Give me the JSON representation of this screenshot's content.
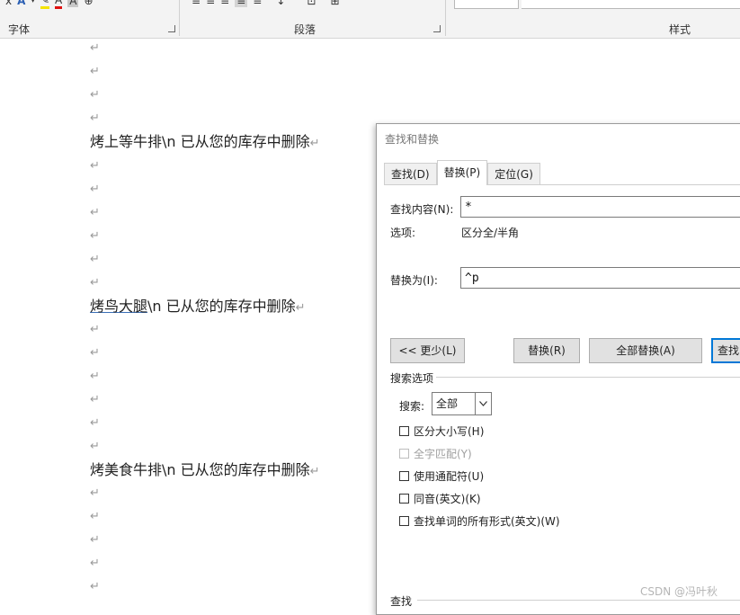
{
  "ribbon": {
    "groups": [
      {
        "label": "字体"
      },
      {
        "label": "段落"
      },
      {
        "label": "样式"
      }
    ],
    "font_tools": [
      "x",
      "A",
      "▾",
      "✎",
      "A",
      "A",
      "⊕"
    ],
    "para_tools": [
      "≡",
      "≡",
      "≡",
      "≡",
      "≡",
      "↕",
      "⊡",
      "⊞"
    ]
  },
  "document": {
    "para_mark": "↵",
    "lines": [
      {
        "text": ""
      },
      {
        "text": ""
      },
      {
        "text": ""
      },
      {
        "text": ""
      },
      {
        "text": "烤上等牛排\\n 已从您的库存中删除"
      },
      {
        "text": ""
      },
      {
        "text": ""
      },
      {
        "text": ""
      },
      {
        "text": ""
      },
      {
        "text": ""
      },
      {
        "text": ""
      },
      {
        "underlined": "烤鸟大腿",
        "text": "\\n 已从您的库存中删除"
      },
      {
        "text": ""
      },
      {
        "text": ""
      },
      {
        "text": ""
      },
      {
        "text": ""
      },
      {
        "text": ""
      },
      {
        "text": ""
      },
      {
        "text": "烤美食牛排\\n 已从您的库存中删除"
      },
      {
        "text": ""
      },
      {
        "text": ""
      },
      {
        "text": ""
      },
      {
        "text": ""
      },
      {
        "text": ""
      }
    ]
  },
  "dialog": {
    "title": "查找和替换",
    "tabs": [
      {
        "label": "查找(D)",
        "active": false
      },
      {
        "label": "替换(P)",
        "active": true
      },
      {
        "label": "定位(G)",
        "active": false
      }
    ],
    "find_label": "查找内容(N):",
    "find_value": "*",
    "options_label": "选项:",
    "options_value": "区分全/半角",
    "replace_label": "替换为(I):",
    "replace_value": "^p",
    "buttons": {
      "less": "<< 更少(L)",
      "replace": "替换(R)",
      "replace_all": "全部替换(A)",
      "find_next": "查找"
    },
    "search_options_label": "搜索选项",
    "search_label": "搜索:",
    "search_value": "全部",
    "checkboxes": [
      {
        "label": "区分大小写(H)",
        "disabled": false
      },
      {
        "label": "全字匹配(Y)",
        "disabled": true
      },
      {
        "label": "使用通配符(U)",
        "disabled": false
      },
      {
        "label": "同音(英文)(K)",
        "disabled": false
      },
      {
        "label": "查找单词的所有形式(英文)(W)",
        "disabled": false
      }
    ],
    "find_section_label": "查找"
  },
  "watermark": "CSDN @冯叶秋"
}
